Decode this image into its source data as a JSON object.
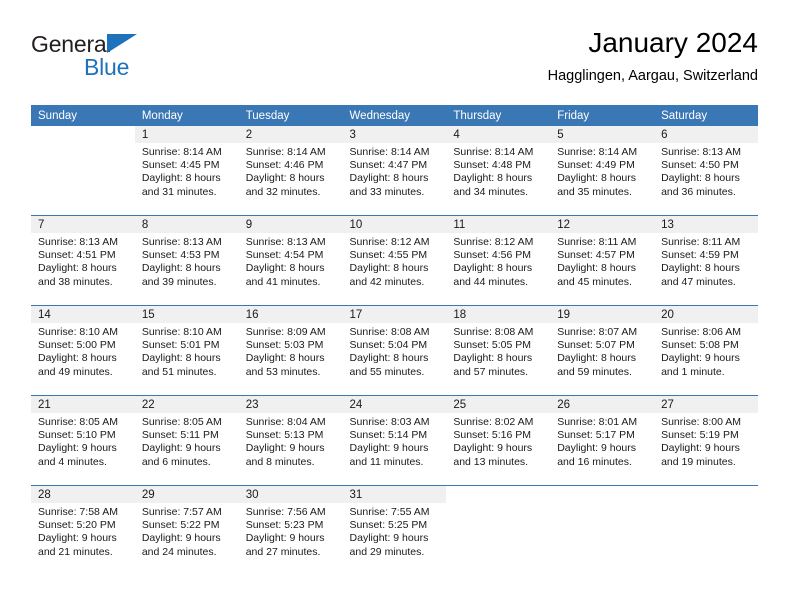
{
  "brand": {
    "name_part1": "General",
    "name_part2": "Blue",
    "triangle_icon": "triangle-icon",
    "color_dark": "#231f20",
    "color_blue": "#1e72bb"
  },
  "header": {
    "title": "January 2024",
    "subtitle": "Hagglingen, Aargau, Switzerland"
  },
  "theme": {
    "header_blue": "#3a77b5",
    "daynum_band": "#f0f0f0",
    "text": "#1a1a1a"
  },
  "weekdays": [
    "Sunday",
    "Monday",
    "Tuesday",
    "Wednesday",
    "Thursday",
    "Friday",
    "Saturday"
  ],
  "weeks": [
    [
      {
        "blank": true
      },
      {
        "day": "1",
        "sunrise": "Sunrise: 8:14 AM",
        "sunset": "Sunset: 4:45 PM",
        "daylight1": "Daylight: 8 hours",
        "daylight2": "and 31 minutes."
      },
      {
        "day": "2",
        "sunrise": "Sunrise: 8:14 AM",
        "sunset": "Sunset: 4:46 PM",
        "daylight1": "Daylight: 8 hours",
        "daylight2": "and 32 minutes."
      },
      {
        "day": "3",
        "sunrise": "Sunrise: 8:14 AM",
        "sunset": "Sunset: 4:47 PM",
        "daylight1": "Daylight: 8 hours",
        "daylight2": "and 33 minutes."
      },
      {
        "day": "4",
        "sunrise": "Sunrise: 8:14 AM",
        "sunset": "Sunset: 4:48 PM",
        "daylight1": "Daylight: 8 hours",
        "daylight2": "and 34 minutes."
      },
      {
        "day": "5",
        "sunrise": "Sunrise: 8:14 AM",
        "sunset": "Sunset: 4:49 PM",
        "daylight1": "Daylight: 8 hours",
        "daylight2": "and 35 minutes."
      },
      {
        "day": "6",
        "sunrise": "Sunrise: 8:13 AM",
        "sunset": "Sunset: 4:50 PM",
        "daylight1": "Daylight: 8 hours",
        "daylight2": "and 36 minutes."
      }
    ],
    [
      {
        "day": "7",
        "sunrise": "Sunrise: 8:13 AM",
        "sunset": "Sunset: 4:51 PM",
        "daylight1": "Daylight: 8 hours",
        "daylight2": "and 38 minutes."
      },
      {
        "day": "8",
        "sunrise": "Sunrise: 8:13 AM",
        "sunset": "Sunset: 4:53 PM",
        "daylight1": "Daylight: 8 hours",
        "daylight2": "and 39 minutes."
      },
      {
        "day": "9",
        "sunrise": "Sunrise: 8:13 AM",
        "sunset": "Sunset: 4:54 PM",
        "daylight1": "Daylight: 8 hours",
        "daylight2": "and 41 minutes."
      },
      {
        "day": "10",
        "sunrise": "Sunrise: 8:12 AM",
        "sunset": "Sunset: 4:55 PM",
        "daylight1": "Daylight: 8 hours",
        "daylight2": "and 42 minutes."
      },
      {
        "day": "11",
        "sunrise": "Sunrise: 8:12 AM",
        "sunset": "Sunset: 4:56 PM",
        "daylight1": "Daylight: 8 hours",
        "daylight2": "and 44 minutes."
      },
      {
        "day": "12",
        "sunrise": "Sunrise: 8:11 AM",
        "sunset": "Sunset: 4:57 PM",
        "daylight1": "Daylight: 8 hours",
        "daylight2": "and 45 minutes."
      },
      {
        "day": "13",
        "sunrise": "Sunrise: 8:11 AM",
        "sunset": "Sunset: 4:59 PM",
        "daylight1": "Daylight: 8 hours",
        "daylight2": "and 47 minutes."
      }
    ],
    [
      {
        "day": "14",
        "sunrise": "Sunrise: 8:10 AM",
        "sunset": "Sunset: 5:00 PM",
        "daylight1": "Daylight: 8 hours",
        "daylight2": "and 49 minutes."
      },
      {
        "day": "15",
        "sunrise": "Sunrise: 8:10 AM",
        "sunset": "Sunset: 5:01 PM",
        "daylight1": "Daylight: 8 hours",
        "daylight2": "and 51 minutes."
      },
      {
        "day": "16",
        "sunrise": "Sunrise: 8:09 AM",
        "sunset": "Sunset: 5:03 PM",
        "daylight1": "Daylight: 8 hours",
        "daylight2": "and 53 minutes."
      },
      {
        "day": "17",
        "sunrise": "Sunrise: 8:08 AM",
        "sunset": "Sunset: 5:04 PM",
        "daylight1": "Daylight: 8 hours",
        "daylight2": "and 55 minutes."
      },
      {
        "day": "18",
        "sunrise": "Sunrise: 8:08 AM",
        "sunset": "Sunset: 5:05 PM",
        "daylight1": "Daylight: 8 hours",
        "daylight2": "and 57 minutes."
      },
      {
        "day": "19",
        "sunrise": "Sunrise: 8:07 AM",
        "sunset": "Sunset: 5:07 PM",
        "daylight1": "Daylight: 8 hours",
        "daylight2": "and 59 minutes."
      },
      {
        "day": "20",
        "sunrise": "Sunrise: 8:06 AM",
        "sunset": "Sunset: 5:08 PM",
        "daylight1": "Daylight: 9 hours",
        "daylight2": "and 1 minute."
      }
    ],
    [
      {
        "day": "21",
        "sunrise": "Sunrise: 8:05 AM",
        "sunset": "Sunset: 5:10 PM",
        "daylight1": "Daylight: 9 hours",
        "daylight2": "and 4 minutes."
      },
      {
        "day": "22",
        "sunrise": "Sunrise: 8:05 AM",
        "sunset": "Sunset: 5:11 PM",
        "daylight1": "Daylight: 9 hours",
        "daylight2": "and 6 minutes."
      },
      {
        "day": "23",
        "sunrise": "Sunrise: 8:04 AM",
        "sunset": "Sunset: 5:13 PM",
        "daylight1": "Daylight: 9 hours",
        "daylight2": "and 8 minutes."
      },
      {
        "day": "24",
        "sunrise": "Sunrise: 8:03 AM",
        "sunset": "Sunset: 5:14 PM",
        "daylight1": "Daylight: 9 hours",
        "daylight2": "and 11 minutes."
      },
      {
        "day": "25",
        "sunrise": "Sunrise: 8:02 AM",
        "sunset": "Sunset: 5:16 PM",
        "daylight1": "Daylight: 9 hours",
        "daylight2": "and 13 minutes."
      },
      {
        "day": "26",
        "sunrise": "Sunrise: 8:01 AM",
        "sunset": "Sunset: 5:17 PM",
        "daylight1": "Daylight: 9 hours",
        "daylight2": "and 16 minutes."
      },
      {
        "day": "27",
        "sunrise": "Sunrise: 8:00 AM",
        "sunset": "Sunset: 5:19 PM",
        "daylight1": "Daylight: 9 hours",
        "daylight2": "and 19 minutes."
      }
    ],
    [
      {
        "day": "28",
        "sunrise": "Sunrise: 7:58 AM",
        "sunset": "Sunset: 5:20 PM",
        "daylight1": "Daylight: 9 hours",
        "daylight2": "and 21 minutes."
      },
      {
        "day": "29",
        "sunrise": "Sunrise: 7:57 AM",
        "sunset": "Sunset: 5:22 PM",
        "daylight1": "Daylight: 9 hours",
        "daylight2": "and 24 minutes."
      },
      {
        "day": "30",
        "sunrise": "Sunrise: 7:56 AM",
        "sunset": "Sunset: 5:23 PM",
        "daylight1": "Daylight: 9 hours",
        "daylight2": "and 27 minutes."
      },
      {
        "day": "31",
        "sunrise": "Sunrise: 7:55 AM",
        "sunset": "Sunset: 5:25 PM",
        "daylight1": "Daylight: 9 hours",
        "daylight2": "and 29 minutes."
      },
      {
        "blank": true
      },
      {
        "blank": true
      },
      {
        "blank": true
      }
    ]
  ]
}
